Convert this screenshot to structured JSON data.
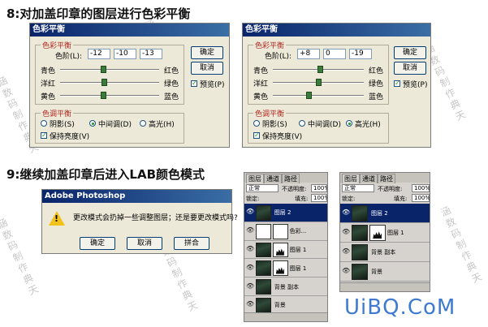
{
  "heading_1": "8:对加盖印章的图层进行色彩平衡",
  "heading_2": "9:继续加盖印章后进入LAB颜色模式",
  "watermark": "涵数码制作典天",
  "color_balance": {
    "title": "色彩平衡",
    "section_balance": "色彩平衡",
    "levels_label": "色阶(L):",
    "color_rows": [
      {
        "left": "青色",
        "right": "红色"
      },
      {
        "left": "洋红",
        "right": "绿色"
      },
      {
        "left": "黄色",
        "right": "蓝色"
      }
    ],
    "section_tone": "色调平衡",
    "tone_options": [
      "阴影(S)",
      "中间调(D)",
      "高光(H)"
    ],
    "preserve_luminosity": "保持亮度(V)",
    "ok": "确定",
    "cancel": "取消",
    "preview": "预览(P)"
  },
  "dialog_left": {
    "levels": [
      "-12",
      "-10",
      "-13"
    ],
    "selected_tone": "中间调(D)",
    "slider_positions": [
      0.44,
      0.45,
      0.44
    ]
  },
  "dialog_right": {
    "levels": [
      "+8",
      "0",
      "-19"
    ],
    "selected_tone": "高光(H)",
    "slider_positions": [
      0.52,
      0.5,
      0.4
    ]
  },
  "alert": {
    "title": "Adobe Photoshop",
    "message": "更改模式会扔掉一些调整图层；还是要更改模式吗?",
    "buttons": [
      "确定",
      "取消",
      "拼合"
    ]
  },
  "layers_panel": {
    "tabs": [
      "图层",
      "通道",
      "路径"
    ],
    "blend_mode": "正常",
    "opacity_label": "不透明度:",
    "opacity_value": "100%",
    "lock_label": "锁定:",
    "fill_label": "填充:",
    "fill_value": "100%"
  },
  "layers_left": [
    {
      "name": "图层 2",
      "type": "pixel",
      "active": true
    },
    {
      "name": "色彩...",
      "type": "adjust",
      "active": false
    },
    {
      "name": "图层 1",
      "type": "mask",
      "active": false
    },
    {
      "name": "图层 1",
      "type": "mask2",
      "active": false
    },
    {
      "name": "背景 副本",
      "type": "pixel",
      "active": false
    },
    {
      "name": "背景",
      "type": "pixel",
      "active": false
    }
  ],
  "layers_right": [
    {
      "name": "图层 2",
      "type": "pixel",
      "active": true
    },
    {
      "name": "图层 1",
      "type": "mask",
      "active": false
    },
    {
      "name": "背景 副本",
      "type": "pixel",
      "active": false
    },
    {
      "name": "背景",
      "type": "pixel",
      "active": false
    }
  ],
  "site_logo": "UiBQ.CoM"
}
